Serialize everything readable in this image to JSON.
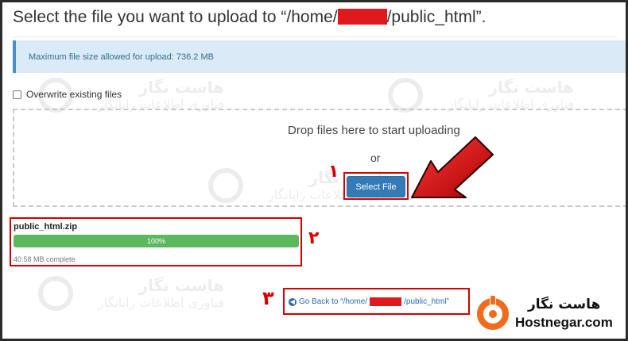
{
  "page": {
    "title_prefix": "Select the file you want to upload to “/home/",
    "title_suffix": "/public_html”."
  },
  "info": {
    "message": "Maximum file size allowed for upload: 736.2 MB"
  },
  "overwrite": {
    "label": "Overwrite existing files",
    "checked": false
  },
  "dropzone": {
    "prompt": "Drop files here to start uploading",
    "or_text": "or",
    "select_button": "Select File"
  },
  "upload": {
    "file_name": "public_html.zip",
    "progress_label": "100%",
    "progress": 1.0,
    "status": "40.58 MB complete"
  },
  "back": {
    "icon": "circle-arrow-left-icon",
    "text_prefix": "Go Back to “/home/",
    "text_suffix": "/public_html”"
  },
  "annotations": {
    "step1": "١",
    "step2": "٢",
    "step3": "٣",
    "highlight_color": "#d40000"
  },
  "watermark": {
    "name": "هاست نگار",
    "tagline": "فناوری اطلاعات رایانگار"
  },
  "logo": {
    "name": "هاست نگار",
    "domain": "Hostnegar.com"
  },
  "colors": {
    "primary_button": "#337ab7",
    "progress_fill": "#5cb85c",
    "info_bg": "#dbeaf7",
    "info_border": "#4a90c8",
    "link": "#2b6cb0"
  }
}
